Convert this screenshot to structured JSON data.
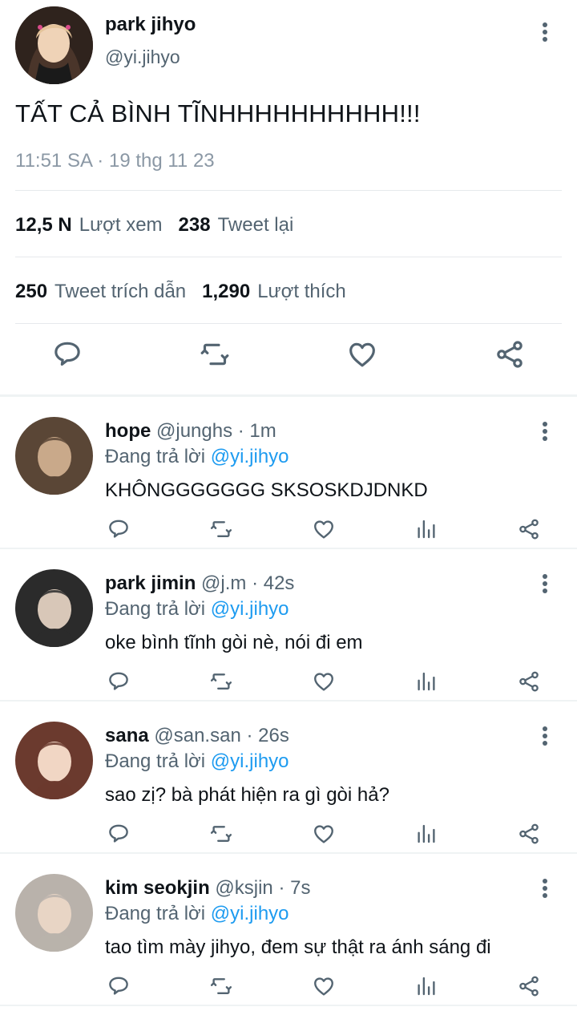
{
  "main_tweet": {
    "name": "park jihyo",
    "handle": "@yi.jihyo",
    "text": "TẤT CẢ BÌNH TĨNHHHHHHHHHH!!!",
    "time": "11:51 SA · 19 thg 11 23",
    "stats": {
      "views_count": "12,5 N",
      "views_label": "Lượt xem",
      "retweets_count": "238",
      "retweets_label": "Tweet lại",
      "quotes_count": "250",
      "quotes_label": "Tweet trích dẫn",
      "likes_count": "1,290",
      "likes_label": "Lượt thích"
    }
  },
  "replies": [
    {
      "name": "hope",
      "meta": "@junghs · 1m",
      "replying_prefix": "Đang trả lời",
      "replying_to": "@yi.jihyo",
      "text": "KHÔNGGGGGGG SKSOSKDJDNKD",
      "avatar_colors": [
        "#5a4636",
        "#c9a98a"
      ]
    },
    {
      "name": "park jimin",
      "meta": "@j.m · 42s",
      "replying_prefix": "Đang trả lời",
      "replying_to": "@yi.jihyo",
      "text": "oke bình tĩnh gòi nè, nói đi em",
      "avatar_colors": [
        "#2b2b2b",
        "#d8c7b8"
      ]
    },
    {
      "name": "sana",
      "meta": "@san.san · 26s",
      "replying_prefix": "Đang trả lời",
      "replying_to": "@yi.jihyo",
      "text": "sao zị? bà phát hiện ra gì gòi hả?",
      "avatar_colors": [
        "#6b3a2e",
        "#f1d6c4"
      ]
    },
    {
      "name": "kim seokjin",
      "meta": "@ksjin · 7s",
      "replying_prefix": "Đang trả lời",
      "replying_to": "@yi.jihyo",
      "text": "tao tìm mày jihyo, đem sự thật ra ánh sáng đi",
      "avatar_colors": [
        "#b9b2ab",
        "#e8d5c5"
      ]
    }
  ],
  "icons": {
    "reply": "reply-icon",
    "retweet": "retweet-icon",
    "like": "like-icon",
    "views": "views-icon",
    "share": "share-icon",
    "more": "more-options-icon"
  },
  "colors": {
    "mention": "#1d9bf0",
    "secondary_text": "#536471",
    "primary_text": "#0f1419",
    "divider": "#eff3f4"
  }
}
